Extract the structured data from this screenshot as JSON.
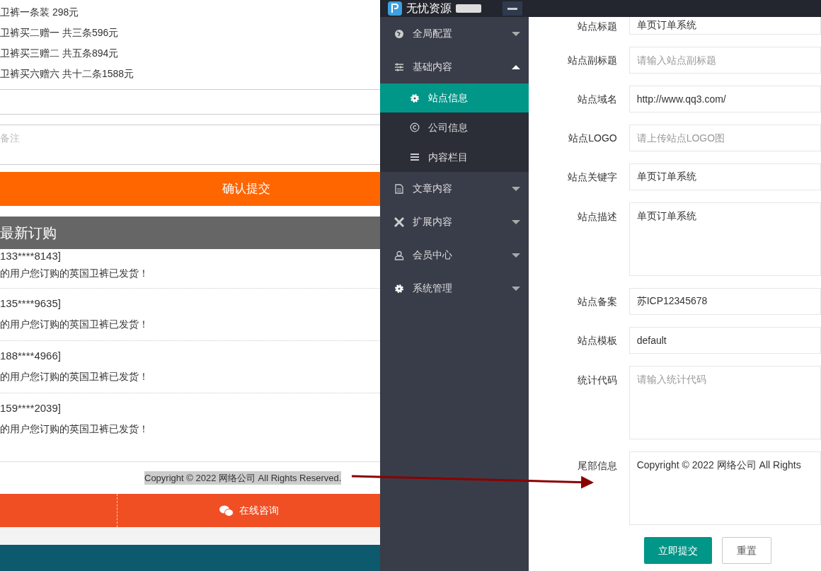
{
  "shop_page": {
    "price_options": [
      "卫裤一条装 298元",
      "卫裤买二赠一 共三条596元",
      "卫裤买三赠二 共五条894元",
      "卫裤买六赠六 共十二条1588元"
    ],
    "remark_field": {
      "placeholder": "备注"
    },
    "submit_button": "确认提交",
    "latest_orders_title": "最新订购",
    "orders": [
      {
        "phone": "133****8143]",
        "message": "的用户您订购的英国卫裤已发货！"
      },
      {
        "phone": "135****9635]",
        "message": "的用户您订购的英国卫裤已发货！"
      },
      {
        "phone": "188****4966]",
        "message": "的用户您订购的英国卫裤已发货！"
      },
      {
        "phone": "159****2039]",
        "message": "的用户您订购的英国卫裤已发货！"
      }
    ],
    "copyright": "Copyright © 2022 网络公司 All Rights Reserved.",
    "consult_button": "在线咨询"
  },
  "admin": {
    "logo_text": "无忧资源",
    "sidebar": [
      {
        "kind": "globe",
        "label": "全局配置",
        "expanded": false
      },
      {
        "kind": "sliders",
        "label": "基础内容",
        "expanded": true,
        "children": [
          {
            "kind": "gear",
            "label": "站点信息",
            "selected": true
          },
          {
            "kind": "copyright",
            "label": "公司信息",
            "selected": false
          },
          {
            "kind": "list",
            "label": "内容栏目",
            "selected": false
          }
        ]
      },
      {
        "kind": "document",
        "label": "文章内容",
        "expanded": false
      },
      {
        "kind": "expand",
        "label": "扩展内容",
        "expanded": false
      },
      {
        "kind": "user",
        "label": "会员中心",
        "expanded": false
      },
      {
        "kind": "gear",
        "label": "系统管理",
        "expanded": false
      }
    ],
    "form": [
      {
        "kind": "input",
        "label": "站点标题",
        "value": "单页订单系统"
      },
      {
        "kind": "input",
        "label": "站点副标题",
        "placeholder": "请输入站点副标题"
      },
      {
        "kind": "input",
        "label": "站点域名",
        "value": "http://www.qq3.com/"
      },
      {
        "kind": "input",
        "label": "站点LOGO",
        "placeholder": "请上传站点LOGO图"
      },
      {
        "kind": "input",
        "label": "站点关键字",
        "value": "单页订单系统"
      },
      {
        "kind": "textarea",
        "label": "站点描述",
        "value": "单页订单系统"
      },
      {
        "kind": "input",
        "label": "站点备案",
        "value": "苏ICP12345678"
      },
      {
        "kind": "input",
        "label": "站点模板",
        "value": "default"
      },
      {
        "kind": "textarea",
        "label": "统计代码",
        "placeholder": "请输入统计代码"
      },
      {
        "kind": "textarea",
        "label": "尾部信息",
        "value": "Copyright © 2022 网络公司 All Rights"
      }
    ],
    "buttons": [
      {
        "kind": "primary",
        "label": "立即提交"
      },
      {
        "kind": "plain",
        "label": "重置"
      }
    ]
  }
}
